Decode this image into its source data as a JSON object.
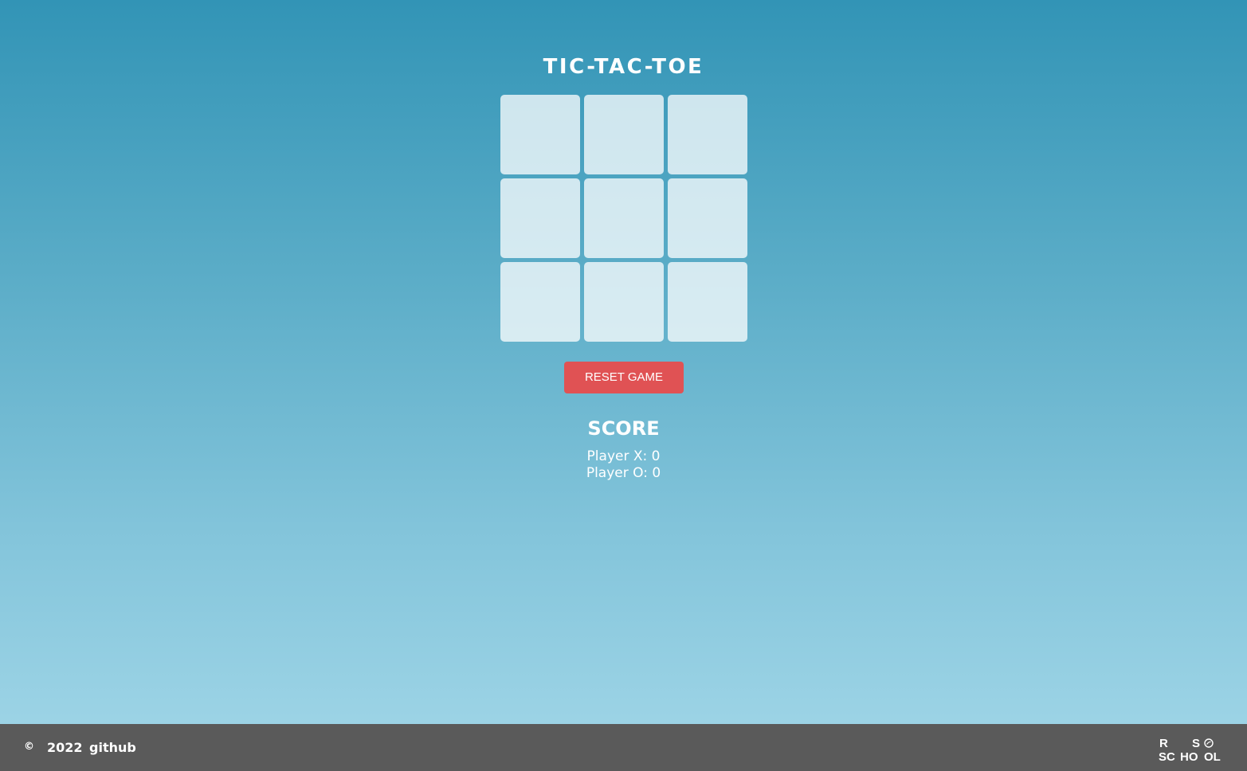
{
  "title": "TIC-TAC-TOE",
  "board": {
    "cells": [
      "",
      "",
      "",
      "",
      "",
      "",
      "",
      "",
      ""
    ]
  },
  "reset_button_label": "RESET GAME",
  "score": {
    "heading": "SCORE",
    "player_x": "Player X: 0",
    "player_o": "Player O: 0"
  },
  "footer": {
    "copyright_symbol": "©",
    "year": "2022",
    "link_label": "github",
    "logo_text": "RS SCHOOL",
    "background_color": "#5a5a5a"
  },
  "colors": {
    "accent_button": "#e05254",
    "background_top": "#3294b6",
    "background_bottom": "#a2d7e8"
  }
}
